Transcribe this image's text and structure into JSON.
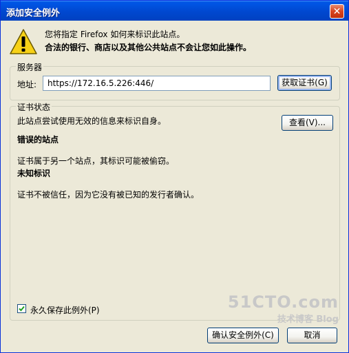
{
  "window": {
    "title": "添加安全例外",
    "close_label": "✕"
  },
  "message": {
    "line1": "您将指定 Firefox 如何来标识此站点。",
    "line2": "合法的银行、商店以及其他公共站点不会让您如此操作。"
  },
  "server": {
    "group_label": "服务器",
    "address_label": "地址:",
    "address_value": "https://172.16.5.226:446/",
    "get_cert_button": "获取证书(G)"
  },
  "cert_status": {
    "group_label": "证书状态",
    "summary": "此站点尝试使用无效的信息来标识自身。",
    "view_button": "查看(V)...",
    "wrong_site_heading": "错误的站点",
    "wrong_site_text": "证书属于另一个站点，其标识可能被偷窃。",
    "unknown_id_heading": "未知标识",
    "unknown_id_text": "证书不被信任，因为它没有被已知的发行者确认。"
  },
  "permanent": {
    "label": "永久保存此例外(P)",
    "checked": true
  },
  "buttons": {
    "confirm": "确认安全例外(C)",
    "cancel": "取消"
  },
  "watermark": {
    "main": "51CTO.com",
    "sub": "技术博客  Blog"
  }
}
